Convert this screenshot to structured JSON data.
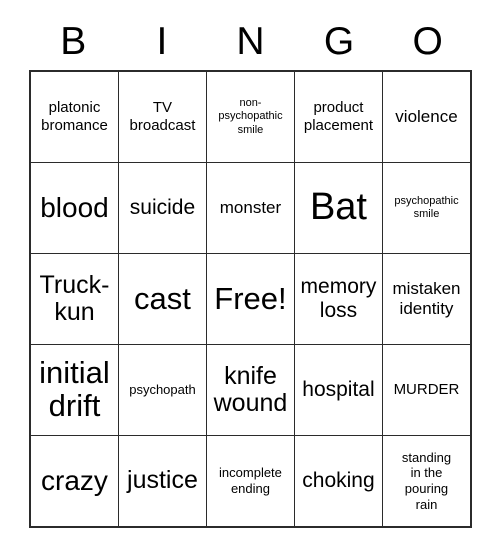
{
  "card": {
    "header_letters": [
      "B",
      "I",
      "N",
      "G",
      "O"
    ],
    "rows": [
      [
        {
          "text": "platonic\nbromance",
          "size": "fs-md"
        },
        {
          "text": "TV\nbroadcast",
          "size": "fs-md"
        },
        {
          "text": "non-\npsychopathic\nsmile",
          "size": "fs-xs"
        },
        {
          "text": "product\nplacement",
          "size": "fs-md"
        },
        {
          "text": "violence",
          "size": "fs-lg"
        }
      ],
      [
        {
          "text": "blood",
          "size": "fs-3xl"
        },
        {
          "text": "suicide",
          "size": "fs-xl"
        },
        {
          "text": "monster",
          "size": "fs-lg"
        },
        {
          "text": "Bat",
          "size": "fs-5xl"
        },
        {
          "text": "psychopathic\nsmile",
          "size": "fs-xs"
        }
      ],
      [
        {
          "text": "Truck-\nkun",
          "size": "fs-2xl"
        },
        {
          "text": "cast",
          "size": "fs-4xl"
        },
        {
          "text": "Free!",
          "size": "fs-4xl"
        },
        {
          "text": "memory\nloss",
          "size": "fs-xl"
        },
        {
          "text": "mistaken\nidentity",
          "size": "fs-lg"
        }
      ],
      [
        {
          "text": "initial\ndrift",
          "size": "fs-4xl"
        },
        {
          "text": "psychopath",
          "size": "fs-sm"
        },
        {
          "text": "knife\nwound",
          "size": "fs-2xl"
        },
        {
          "text": "hospital",
          "size": "fs-xl"
        },
        {
          "text": "MURDER",
          "size": "fs-md"
        }
      ],
      [
        {
          "text": "crazy",
          "size": "fs-3xl"
        },
        {
          "text": "justice",
          "size": "fs-2xl"
        },
        {
          "text": "incomplete\nending",
          "size": "fs-sm"
        },
        {
          "text": "choking",
          "size": "fs-xl"
        },
        {
          "text": "standing\nin the\npouring\nrain",
          "size": "fs-sm"
        }
      ]
    ],
    "colors": {
      "border": "#2b2b2b",
      "text": "#000000",
      "background": "#ffffff"
    }
  }
}
